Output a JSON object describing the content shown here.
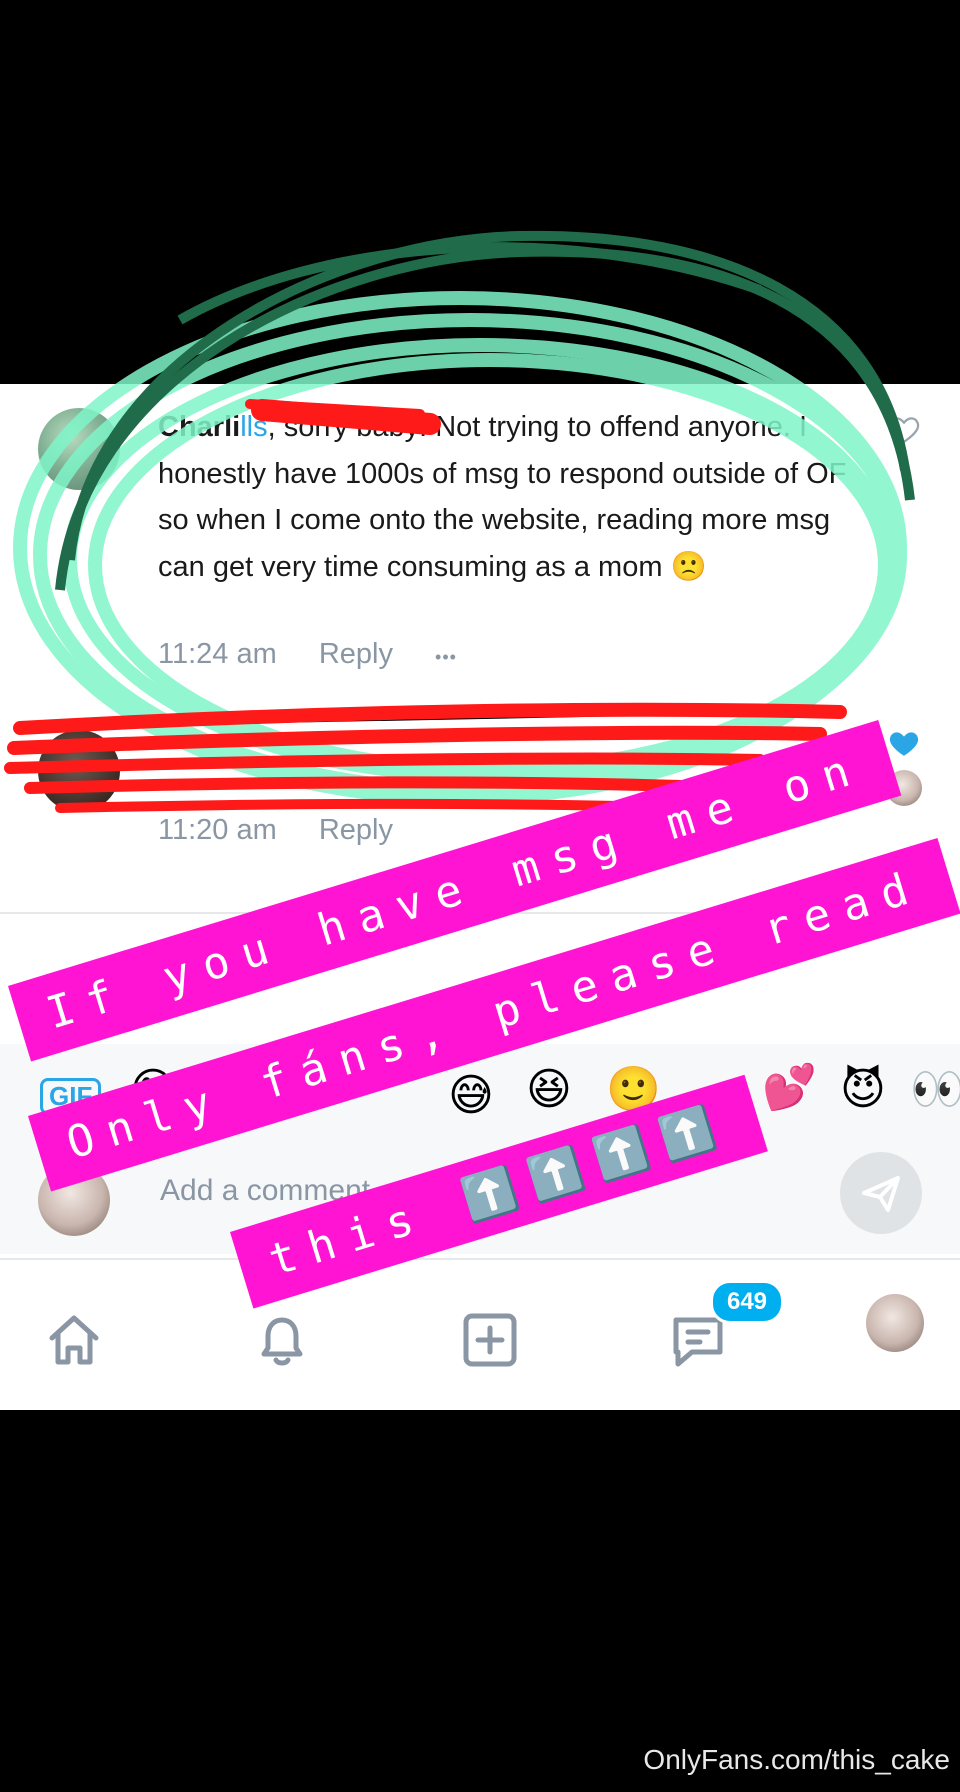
{
  "comments": [
    {
      "name": "Charli",
      "mention": "lls",
      "text": ", sorry baby! Not trying to offend anyone. I honestly have 1000s of msg to respond outside of OF so when I come onto the website, reading more msg can get very time consuming as a mom 🙁",
      "time": "11:24 am",
      "reply_label": "Reply",
      "more_label": "•••",
      "liked": false
    },
    {
      "name": "",
      "time": "11:20 am",
      "reply_label": "Reply",
      "liked": true
    }
  ],
  "emoji_bar": {
    "gif_label": "GIF",
    "emojis": [
      "😊",
      "😅",
      "😆",
      "🙂",
      "💕",
      "😈",
      "👀"
    ]
  },
  "comment_input": {
    "placeholder": "Add a comment"
  },
  "tabbar": {
    "messages_badge": "649",
    "items": [
      "home",
      "notifications",
      "add",
      "messages",
      "profile"
    ]
  },
  "overlay": {
    "line1": "If you have msg me on",
    "line2": "Only fáns, please read",
    "line3": "this ⬆️⬆️⬆️⬆️",
    "highlight_color": "#7ff5c8",
    "outline_color": "#1f6b4a",
    "banner_color": "#ff14d4",
    "redact_color": "#ff1a1a"
  },
  "watermark": "OnlyFans.com/this_cake"
}
